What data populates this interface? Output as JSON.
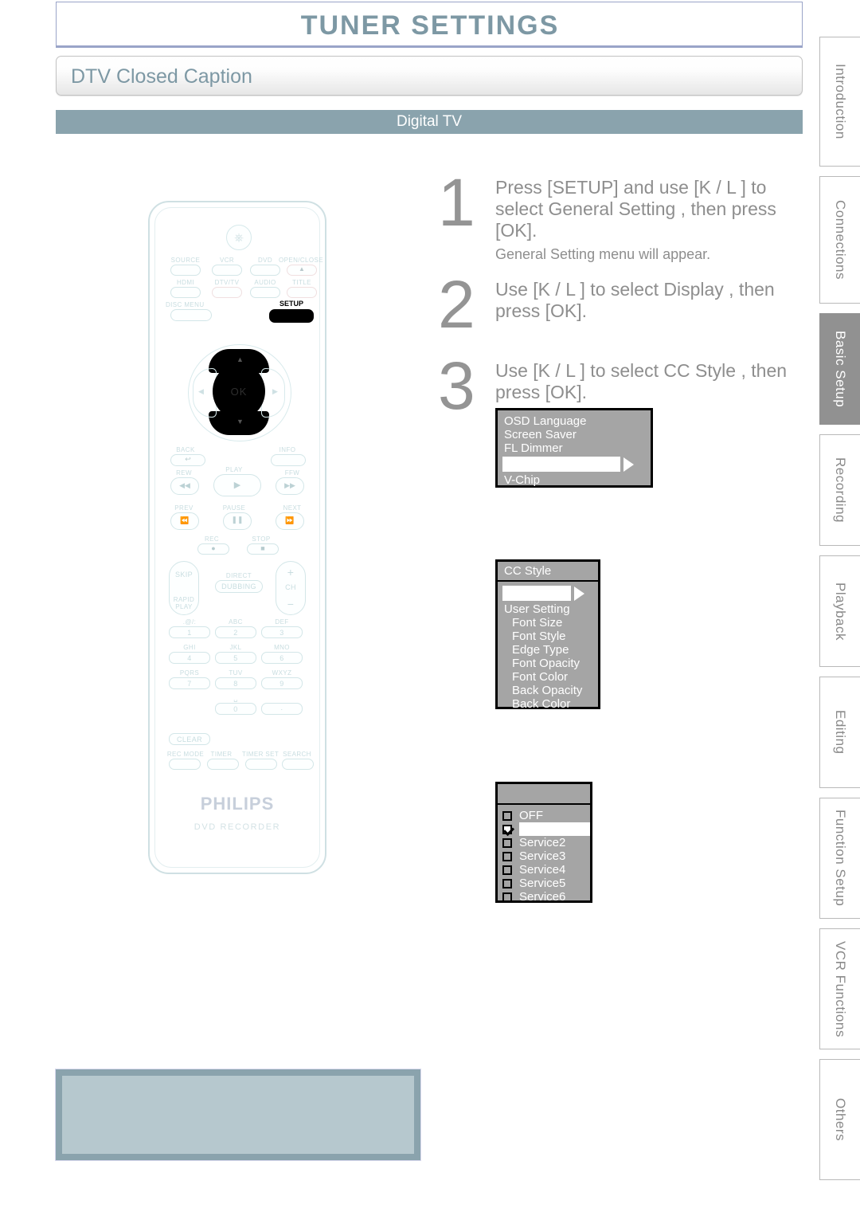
{
  "header": {
    "chapter_title": "TUNER SETTINGS",
    "section_title": "DTV Closed Caption",
    "sub_band": "Digital TV"
  },
  "tabs": [
    {
      "label": "Introduction",
      "active": false
    },
    {
      "label": "Connections",
      "active": false
    },
    {
      "label": "Basic Setup",
      "active": true
    },
    {
      "label": "Recording",
      "active": false
    },
    {
      "label": "Playback",
      "active": false
    },
    {
      "label": "Editing",
      "active": false
    },
    {
      "label": "Function Setup",
      "active": false
    },
    {
      "label": "VCR Functions",
      "active": false
    },
    {
      "label": "Others",
      "active": false
    }
  ],
  "steps": [
    {
      "number": "1",
      "line1": "Press [SETUP] and use [K / L ] to",
      "line2": "select  General Setting , then press",
      "line3": "[OK].",
      "note": "General Setting  menu will appear."
    },
    {
      "number": "2",
      "line1": "Use [K / L ] to select  Display , then",
      "line2": "press [OK]."
    },
    {
      "number": "3",
      "line1": "Use [K / L ] to select  CC Style , then",
      "line2": "press [OK]."
    }
  ],
  "osd_general": {
    "rows": [
      "OSD Language",
      "Screen Saver",
      "FL Dimmer"
    ],
    "highlighted_row": "",
    "rows_after": [
      "V-Chip"
    ]
  },
  "osd_ccstyle": {
    "title": "CC Style",
    "highlighted_row": "",
    "rows": [
      "User Setting",
      "Font Size",
      "Font Style",
      "Edge Type",
      "Font Opacity",
      "Font Color",
      "Back Opacity",
      "Back Color"
    ]
  },
  "osd_service": {
    "title": "",
    "items": [
      {
        "label": "OFF",
        "checked": false,
        "highlighted": false
      },
      {
        "label": "",
        "checked": true,
        "highlighted": true
      },
      {
        "label": "Service2",
        "checked": false,
        "highlighted": false
      },
      {
        "label": "Service3",
        "checked": false,
        "highlighted": false
      },
      {
        "label": "Service4",
        "checked": false,
        "highlighted": false
      },
      {
        "label": "Service5",
        "checked": false,
        "highlighted": false
      },
      {
        "label": "Service6",
        "checked": false,
        "highlighted": false
      }
    ]
  },
  "remote": {
    "brand": "PHILIPS",
    "model": "DVD RECORDER",
    "labels": {
      "power": "power-icon",
      "source": "SOURCE",
      "vcr": "VCR",
      "dvd": "DVD",
      "open_close": "OPEN/CLOSE",
      "hdmi": "HDMI",
      "dtv_tv": "DTV/TV",
      "audio": "AUDIO",
      "title": "TITLE",
      "disc_menu": "DISC MENU",
      "setup": "SETUP",
      "ok": "OK",
      "back": "BACK",
      "info": "INFO",
      "rew": "REW",
      "play": "PLAY",
      "ffw": "FFW",
      "prev": "PREV",
      "pause": "PAUSE",
      "next": "NEXT",
      "rec": "REC",
      "stop": "STOP",
      "skip": "SKIP",
      "rapid_play": "RAPID PLAY",
      "direct": "DIRECT",
      "dubbing": "DUBBING",
      "ch": "CH",
      "plus": "+",
      "minus": "−",
      "clear": "CLEAR",
      "rec_mode": "REC MODE",
      "timer": "TIMER",
      "timer_set": "TIMER SET",
      "search": "SEARCH"
    },
    "keypad": [
      {
        "num": "1",
        "alpha": ".@/:"
      },
      {
        "num": "2",
        "alpha": "ABC"
      },
      {
        "num": "3",
        "alpha": "DEF"
      },
      {
        "num": "4",
        "alpha": "GHI"
      },
      {
        "num": "5",
        "alpha": "JKL"
      },
      {
        "num": "6",
        "alpha": "MNO"
      },
      {
        "num": "7",
        "alpha": "PQRS"
      },
      {
        "num": "8",
        "alpha": "TUV"
      },
      {
        "num": "9",
        "alpha": "WXYZ"
      },
      {
        "num": "0",
        "alpha": "␣"
      },
      {
        "num": "·",
        "alpha": ""
      }
    ]
  },
  "colors": {
    "accent": "#8aa3ad",
    "title_text": "#7d98a4",
    "osd_bg": "#a5a5a5",
    "tab_active": "#919191",
    "note_box_fill": "#b6c8ce"
  }
}
